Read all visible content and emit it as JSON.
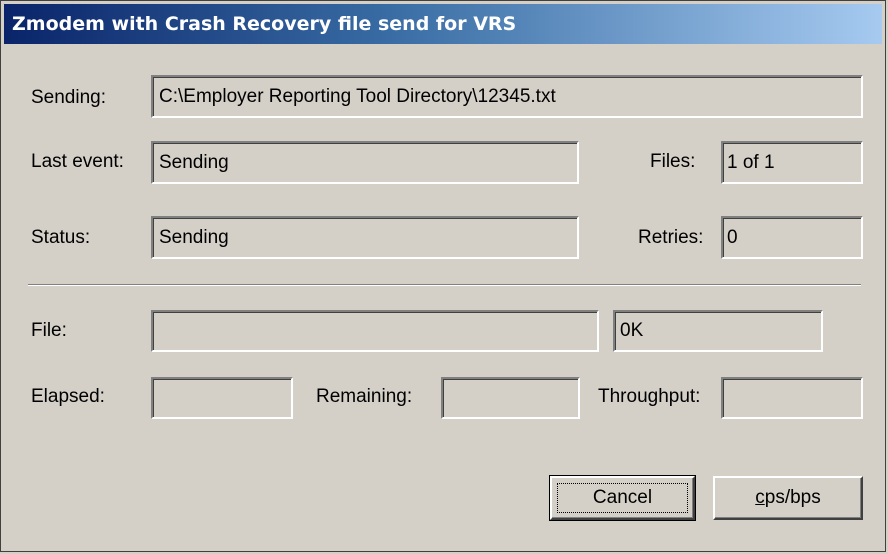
{
  "window": {
    "title": "Zmodem with Crash Recovery file send for VRS"
  },
  "info": {
    "sending_label": "Sending:",
    "sending_value": "C:\\Employer Reporting Tool Directory\\12345.txt",
    "last_event_label": "Last event:",
    "last_event_value": "Sending",
    "files_label": "Files:",
    "files_value": "1 of 1",
    "status_label": "Status:",
    "status_value": "Sending",
    "retries_label": "Retries:",
    "retries_value": "0"
  },
  "progress": {
    "file_label": "File:",
    "file_bar_value": "",
    "file_size": "0K",
    "elapsed_label": "Elapsed:",
    "elapsed_value": "",
    "remaining_label": "Remaining:",
    "remaining_value": "",
    "throughput_label": "Throughput:",
    "throughput_value": ""
  },
  "buttons": {
    "cancel_label": "Cancel",
    "cps_first": "c",
    "cps_rest": "ps/bps"
  }
}
